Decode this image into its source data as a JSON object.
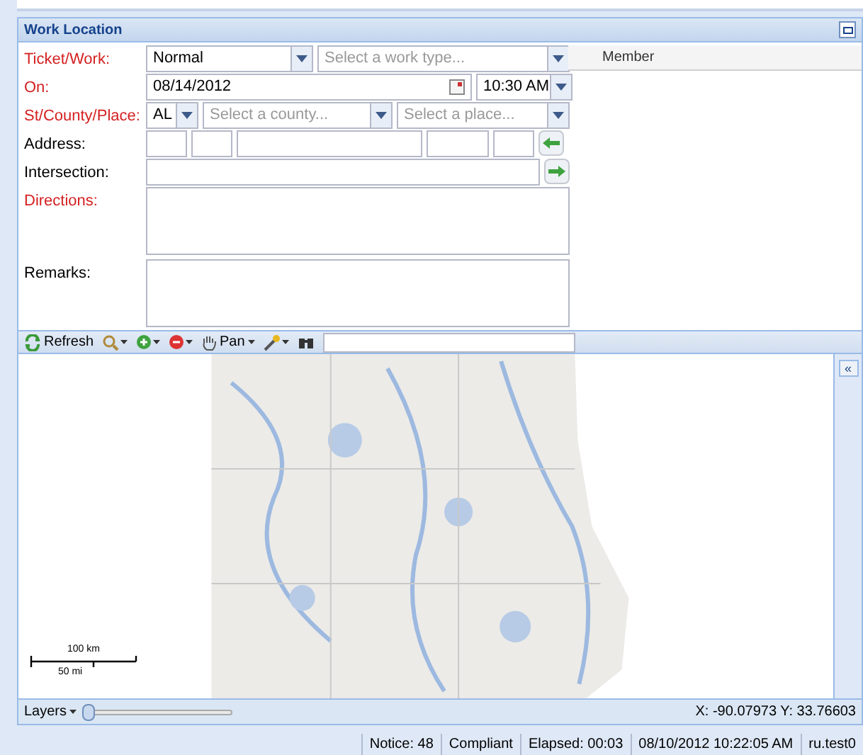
{
  "panel": {
    "title": "Work Location"
  },
  "form": [
    {
      "kind": "ticket",
      "label": "Ticket/Work:",
      "required": true,
      "value": "Normal",
      "placeholder": "Select a work type..."
    },
    {
      "kind": "date",
      "label": "On:",
      "required": true,
      "value": "08/14/2012",
      "time": "10:30 AM"
    },
    {
      "kind": "place",
      "label": "St/County/Place:",
      "required": true,
      "value": "AL",
      "county_placeholder": "Select a county...",
      "place_placeholder": "Select a place..."
    },
    {
      "kind": "address",
      "label": "Address:",
      "required": false
    },
    {
      "kind": "intersection",
      "label": "Intersection:",
      "required": false
    },
    {
      "kind": "directions",
      "label": "Directions:",
      "required": true
    },
    {
      "kind": "remarks",
      "label": "Remarks:",
      "required": false
    }
  ],
  "members": {
    "column": "Member"
  },
  "toolbar": {
    "refresh": "Refresh",
    "pan": "Pan"
  },
  "map": {
    "collapse": "«",
    "scale_km": "100 km",
    "scale_mi": "50 mi"
  },
  "map_footer": {
    "layers": "Layers",
    "level": 0,
    "coords": "X: -90.07973 Y: 33.76603"
  },
  "status_bar": [
    "Notice: 48",
    "Compliant",
    "Elapsed: 00:03",
    "08/10/2012 10:22:05 AM",
    "ru.test0"
  ]
}
